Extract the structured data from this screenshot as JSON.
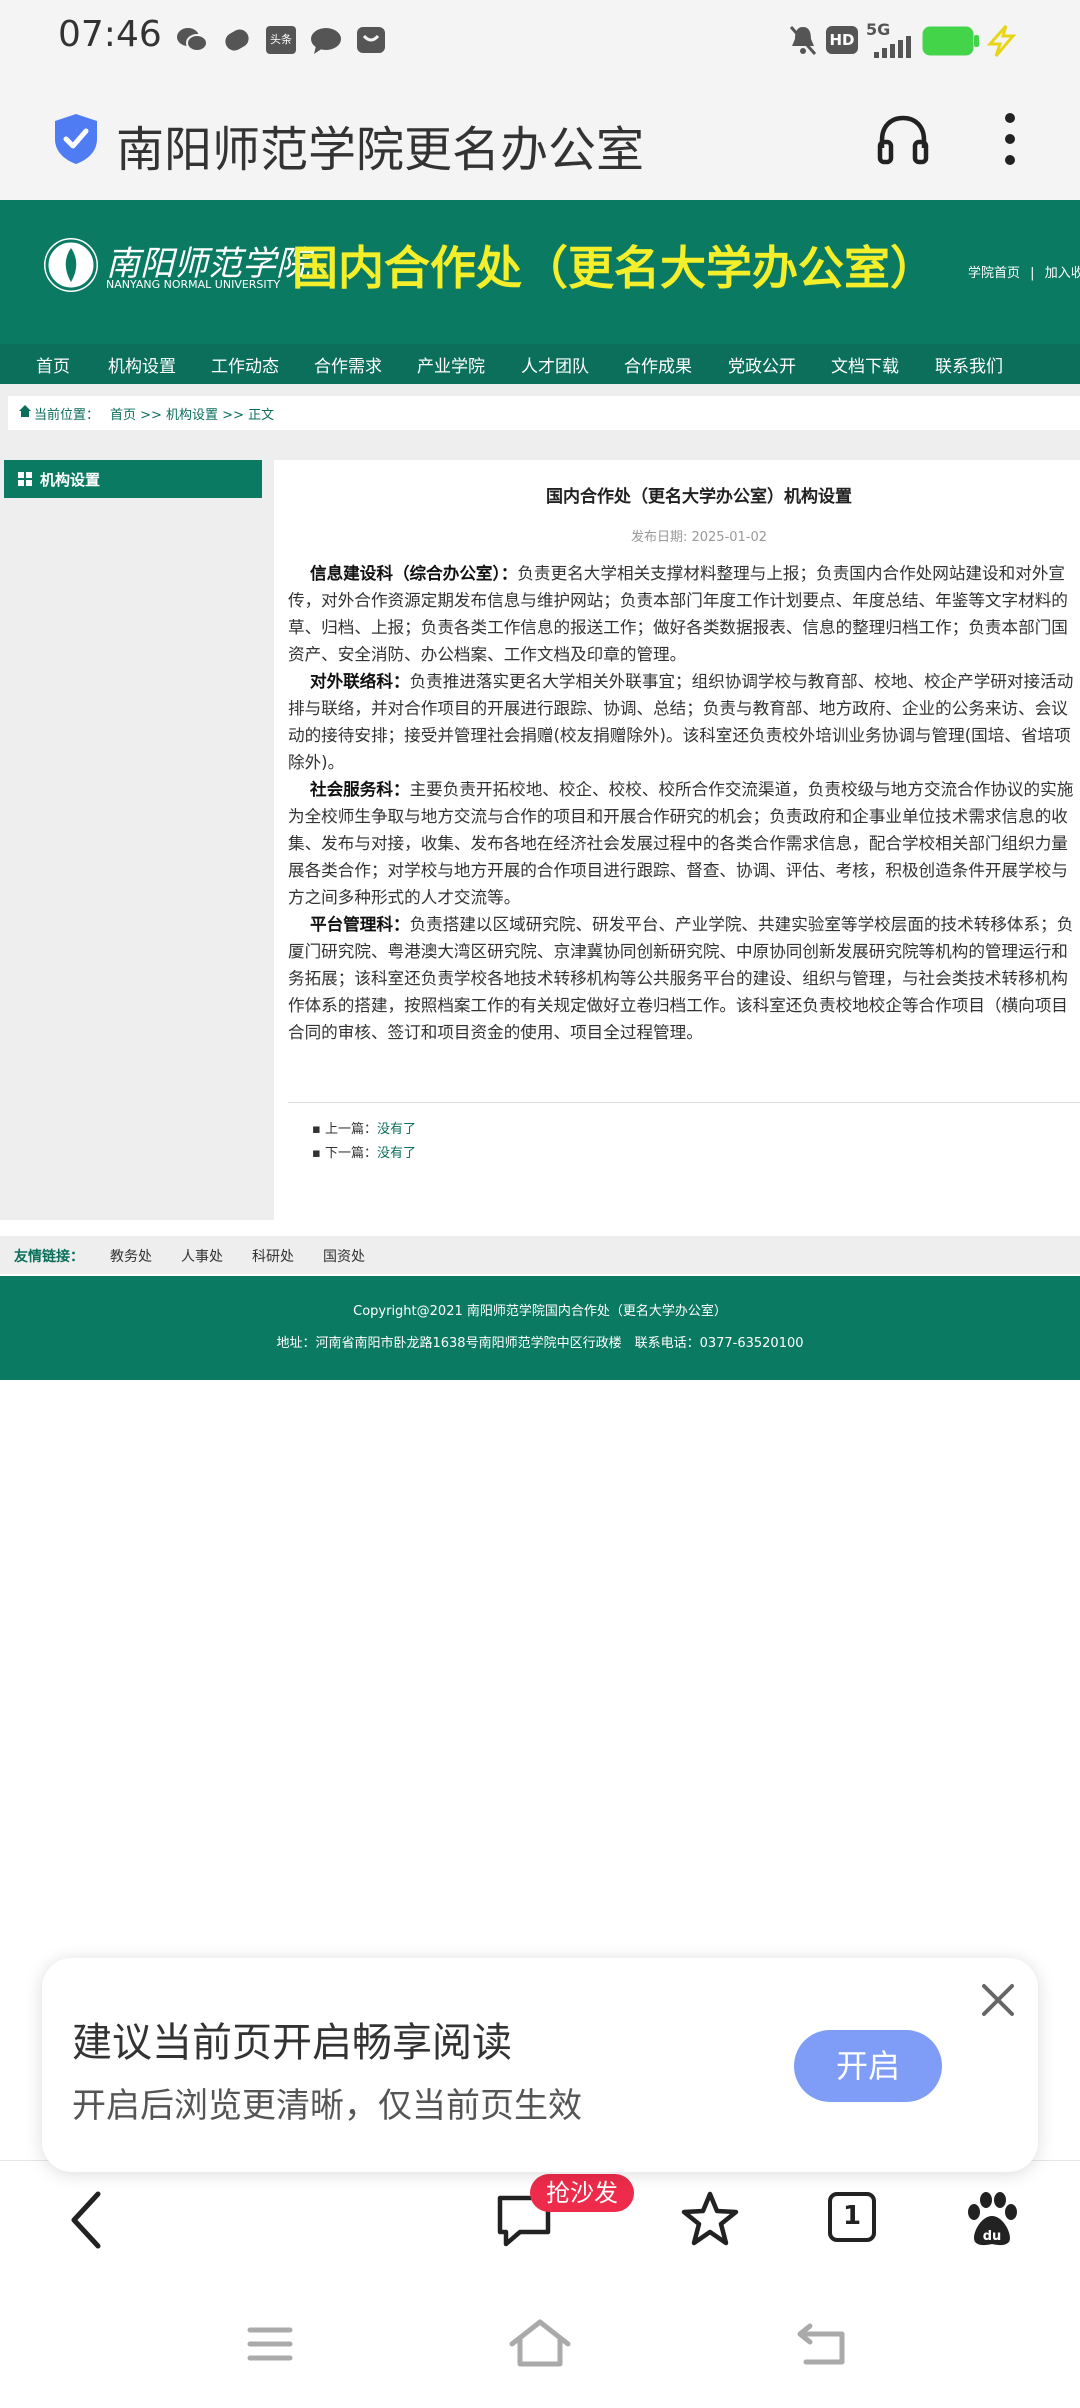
{
  "status_bar": {
    "time": "07:46",
    "network": "5G",
    "hd": "HD",
    "left_icons": [
      "wechat-icon",
      "app-icon",
      "toutiao-icon",
      "message-icon",
      "bag-icon"
    ],
    "toutiao_label": "头条"
  },
  "browser": {
    "page_title": "南阳师范学院更名办公室"
  },
  "site": {
    "logo_cn": "南阳师范学院",
    "logo_en": "NANYANG NORMAL UNIVERSITY",
    "title": "国内合作处（更名大学办公室）",
    "top_links": [
      "学院首页",
      "|",
      "加入收"
    ]
  },
  "nav": {
    "items": [
      "首页",
      "机构设置",
      "工作动态",
      "合作需求",
      "产业学院",
      "人才团队",
      "合作成果",
      "党政公开",
      "文档下载",
      "联系我们"
    ]
  },
  "breadcrumb": {
    "prefix": "当前位置：",
    "path": "首页 >> 机构设置 >> 正文"
  },
  "sidebar": {
    "heading": "机构设置"
  },
  "article": {
    "title": "国内合作处（更名大学办公室）机构设置",
    "date": "发布日期: 2025-01-02",
    "paragraphs": [
      {
        "head": "信息建设科（综合办公室）：",
        "lines": [
          "负责更名大学相关支撑材料整理与上报；负责国内合作处网站建设和对外宣",
          "传，对外合作资源定期发布信息与维护网站；负责本部门年度工作计划要点、年度总结、年鉴等文字材料的",
          "草、归档、上报；负责各类工作信息的报送工作；做好各类数据报表、信息的整理归档工作；负责本部门国",
          "资产、安全消防、办公档案、工作文档及印章的管理。"
        ]
      },
      {
        "head": "对外联络科：",
        "lines": [
          "负责推进落实更名大学相关外联事宜；组织协调学校与教育部、校地、校企产学研对接活动",
          "排与联络，并对合作项目的开展进行跟踪、协调、总结；负责与教育部、地方政府、企业的公务来访、会议",
          "动的接待安排；接受并管理社会捐赠(校友捐赠除外)。该科室还负责校外培训业务协调与管理(国培、省培项",
          "除外)。"
        ]
      },
      {
        "head": "社会服务科：",
        "lines": [
          "主要负责开拓校地、校企、校校、校所合作交流渠道，负责校级与地方交流合作协议的实施",
          "为全校师生争取与地方交流与合作的项目和开展合作研究的机会；负责政府和企事业单位技术需求信息的收",
          "集、发布与对接，收集、发布各地在经济社会发展过程中的各类合作需求信息，配合学校相关部门组织力量",
          "展各类合作；对学校与地方开展的合作项目进行跟踪、督查、协调、评估、考核，积极创造条件开展学校与",
          "方之间多种形式的人才交流等。"
        ]
      },
      {
        "head": "平台管理科：",
        "lines": [
          "负责搭建以区域研究院、研发平台、产业学院、共建实验室等学校层面的技术转移体系；负",
          "厦门研究院、粤港澳大湾区研究院、京津冀协同创新研究院、中原协同创新发展研究院等机构的管理运行和",
          "务拓展；该科室还负责学校各地技术转移机构等公共服务平台的建设、组织与管理，与社会类技术转移机构",
          "作体系的搭建，按照档案工作的有关规定做好立卷归档工作。该科室还负责校地校企等合作项目（横向项目",
          "合同的审核、签订和项目资金的使用、项目全过程管理。"
        ]
      }
    ],
    "prev_label": "上一篇：",
    "prev_value": "没有了",
    "next_label": "下一篇：",
    "next_value": "没有了"
  },
  "friends": {
    "label": "友情链接：",
    "links": [
      "教务处",
      "人事处",
      "科研处",
      "国资处"
    ]
  },
  "footer": {
    "copyright": "Copyright@2021 南阳师范学院国内合作处（更名大学办公室）",
    "address": "地址：河南省南阳市卧龙路1638号南阳师范学院中区行政楼　联系电话：0377-63520100"
  },
  "banner": {
    "title": "建议当前页开启畅享阅读",
    "subtitle": "开启后浏览更清晰，仅当前页生效",
    "button": "开启"
  },
  "toolbar": {
    "badge": "抢沙发",
    "tab_count": "1"
  },
  "colors": {
    "brand_green": "#0b7a63",
    "title_yellow": "#f4ef2a",
    "button_blue": "#7f9cf6",
    "badge_red": "#ee2b4b"
  }
}
